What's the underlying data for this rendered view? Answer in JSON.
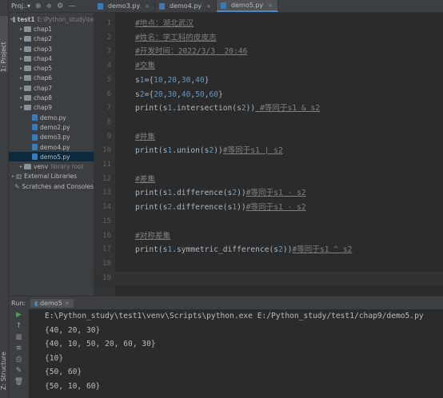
{
  "sidebar_tabs": {
    "project": "1: Project",
    "structure": "Z: Structure"
  },
  "project_panel": {
    "title": "Proj..▾",
    "tree": [
      {
        "type": "folder",
        "label": "test1",
        "suffix": "E:\\Python_study\\te",
        "open": true,
        "depth": 0
      },
      {
        "type": "folder",
        "label": "chap1",
        "depth": 1
      },
      {
        "type": "folder",
        "label": "chap2",
        "depth": 1
      },
      {
        "type": "folder",
        "label": "chap3",
        "depth": 1
      },
      {
        "type": "folder",
        "label": "chap4",
        "depth": 1
      },
      {
        "type": "folder",
        "label": "chap5",
        "depth": 1
      },
      {
        "type": "folder",
        "label": "chap6",
        "depth": 1
      },
      {
        "type": "folder",
        "label": "chap7",
        "depth": 1
      },
      {
        "type": "folder",
        "label": "chap8",
        "depth": 1
      },
      {
        "type": "folder",
        "label": "chap9",
        "open": true,
        "depth": 1
      },
      {
        "type": "file",
        "label": "demo.py",
        "depth": 2
      },
      {
        "type": "file",
        "label": "demo2.py",
        "depth": 2
      },
      {
        "type": "file",
        "label": "demo3.py",
        "depth": 2
      },
      {
        "type": "file",
        "label": "demo4.py",
        "depth": 2
      },
      {
        "type": "file",
        "label": "demo5.py",
        "depth": 2,
        "selected": true
      },
      {
        "type": "folder",
        "label": "venv",
        "suffix": "library root",
        "depth": 1
      },
      {
        "type": "lib",
        "label": "External Libraries",
        "depth": 0
      },
      {
        "type": "scratch",
        "label": "Scratches and Consoles",
        "depth": 0
      }
    ]
  },
  "editor_tabs": [
    {
      "label": "demo3.py",
      "active": false
    },
    {
      "label": "demo4.py",
      "active": false
    },
    {
      "label": "demo5.py",
      "active": true
    }
  ],
  "code_lines": [
    {
      "n": "1",
      "text": "#地点：湖北武汉",
      "kind": "comment"
    },
    {
      "n": "2",
      "text": "#姓名：学工科的皮皮志",
      "kind": "comment"
    },
    {
      "n": "3",
      "text": "#开发时间：2022/3/3  20:46",
      "kind": "comment"
    },
    {
      "n": "4",
      "text": "#交集",
      "kind": "comment"
    },
    {
      "n": "5",
      "text": "s1={10,20,30,40}",
      "kind": "code"
    },
    {
      "n": "6",
      "text": "s2={20,30,40,50,60}",
      "kind": "code"
    },
    {
      "n": "7",
      "text": "print(s1.intersection(s2))",
      "tail": " #等同于s1 & s2",
      "kind": "mixed"
    },
    {
      "n": "8",
      "text": "",
      "kind": "code"
    },
    {
      "n": "9",
      "text": "#并集",
      "kind": "comment"
    },
    {
      "n": "10",
      "text": "print(s1.union(s2))",
      "tail": "#等同于s1 | s2",
      "kind": "mixed"
    },
    {
      "n": "11",
      "text": "",
      "kind": "code"
    },
    {
      "n": "12",
      "text": "#差集",
      "kind": "comment"
    },
    {
      "n": "13",
      "text": "print(s1.difference(s2))",
      "tail": "#等同于s1 - s2",
      "kind": "mixed"
    },
    {
      "n": "14",
      "text": "print(s2.difference(s1))",
      "tail": "#等同于s1 - s2",
      "kind": "mixed"
    },
    {
      "n": "15",
      "text": "",
      "kind": "code"
    },
    {
      "n": "16",
      "text": "#对称差集",
      "kind": "comment"
    },
    {
      "n": "17",
      "text": "print(s1.symmetric_difference(s2))",
      "tail": "#等同于s1 ^ s2",
      "kind": "mixed"
    },
    {
      "n": "18",
      "text": "",
      "kind": "code"
    },
    {
      "n": "19",
      "text": "",
      "kind": "code",
      "current": true
    }
  ],
  "run_panel": {
    "label": "Run:",
    "tab": "demo5",
    "output": [
      "E:\\Python_study\\test1\\venv\\Scripts\\python.exe E:/Python_study/test1/chap9/demo5.py",
      "{40, 20, 30}",
      "{40, 10, 50, 20, 60, 30}",
      "{10}",
      "{50, 60}",
      "{50, 10, 60}"
    ]
  },
  "colors": {
    "accent": "#4a88c7",
    "run_green": "#499c54",
    "comment": "#808080",
    "number": "#6897bb"
  }
}
